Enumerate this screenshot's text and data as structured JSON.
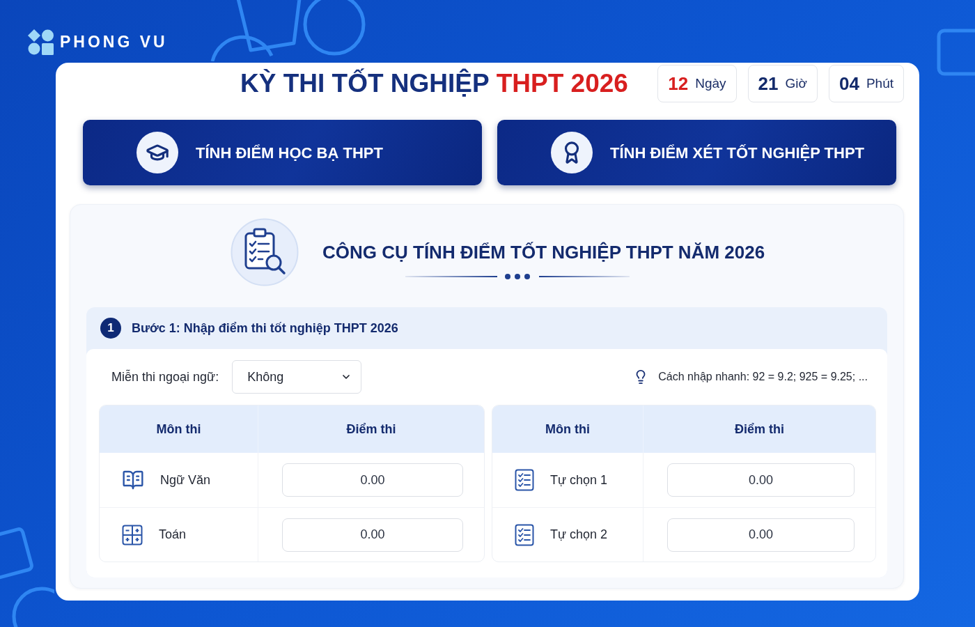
{
  "brand": {
    "name": "PHONG VU"
  },
  "header": {
    "title": "KỲ THI TỐT NGHIỆP",
    "title_highlight": "THPT 2026",
    "countdown": [
      {
        "value": "12",
        "unit": "Ngày",
        "highlighted": true
      },
      {
        "value": "21",
        "unit": "Giờ",
        "highlighted": false
      },
      {
        "value": "04",
        "unit": "Phút",
        "highlighted": false
      }
    ]
  },
  "mode_buttons": [
    {
      "kind": "transcript",
      "label": "TÍNH ĐIỂM HỌC BẠ THPT"
    },
    {
      "kind": "graduation",
      "label": "TÍNH ĐIỂM XÉT TỐT NGHIỆP THPT"
    }
  ],
  "tool": {
    "title": "CÔNG CỤ TÍNH ĐIỂM TỐT NGHIỆP THPT NĂM 2026",
    "step": {
      "number": "1",
      "title": "Bước 1: Nhập điểm thi tốt nghiệp THPT 2026",
      "exemption": {
        "label": "Miễn thi ngoại ngữ:",
        "value": "Không"
      },
      "hint": "Cách nhập nhanh: 92 = 9.2; 925 = 9.25; ...",
      "tables": [
        {
          "columns": [
            "Môn thi",
            "Điểm thi"
          ],
          "rows": [
            {
              "kind": "literature",
              "subject": "Ngữ Văn",
              "score": "0.00"
            },
            {
              "kind": "math",
              "subject": "Toán",
              "score": "0.00"
            }
          ]
        },
        {
          "columns": [
            "Môn thi",
            "Điểm thi"
          ],
          "rows": [
            {
              "kind": "elective",
              "subject": "Tự chọn 1",
              "score": "0.00"
            },
            {
              "kind": "elective",
              "subject": "Tự chọn 2",
              "score": "0.00"
            }
          ]
        }
      ]
    }
  }
}
